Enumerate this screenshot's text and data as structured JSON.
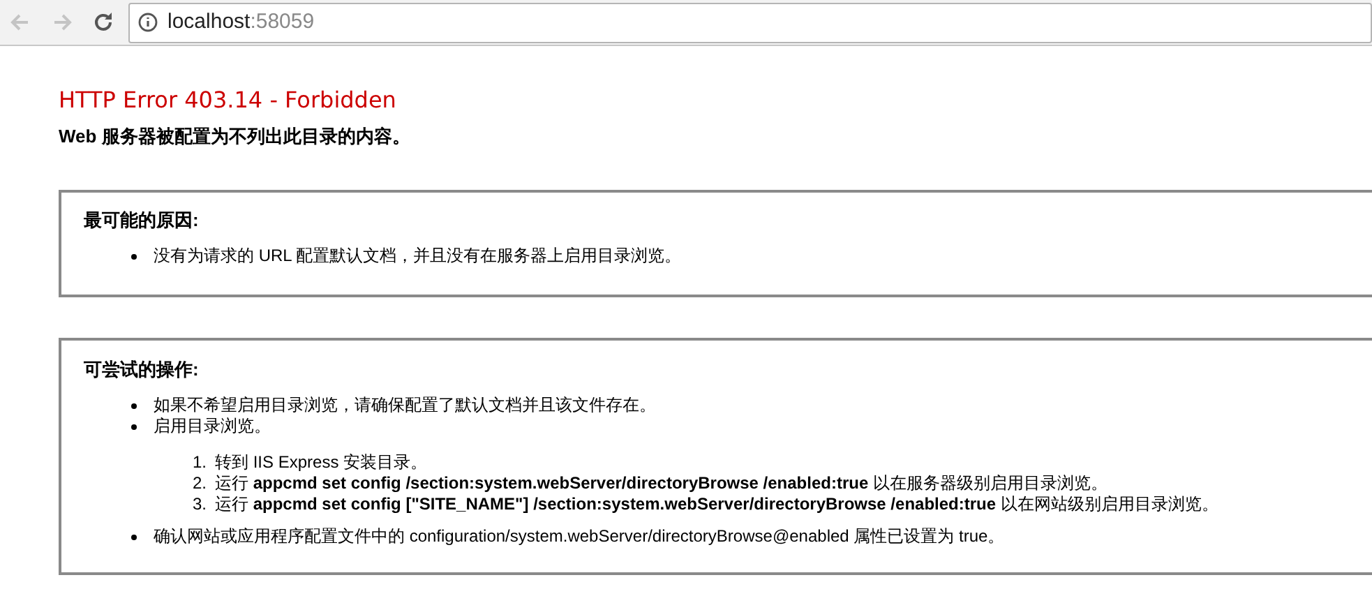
{
  "browser": {
    "address_host": "localhost",
    "address_port": ":58059"
  },
  "error": {
    "title": "HTTP Error 403.14 - Forbidden",
    "subtitle": "Web 服务器被配置为不列出此目录的内容。"
  },
  "sections": [
    {
      "heading": "最可能的原因:",
      "items": [
        {
          "text": "没有为请求的 URL 配置默认文档，并且没有在服务器上启用目录浏览。"
        }
      ]
    },
    {
      "heading": "可尝试的操作:",
      "items": [
        {
          "text": "如果不希望启用目录浏览，请确保配置了默认文档并且该文件存在。"
        },
        {
          "text": "启用目录浏览。",
          "steps": [
            {
              "number": "1.",
              "text": "转到 IIS Express 安装目录。"
            },
            {
              "number": "2.",
              "text": "运行 **appcmd set config /section:system.webServer/directoryBrowse /enabled:true** 以在服务器级别启用目录浏览。"
            },
            {
              "number": "3.",
              "text": "运行 **appcmd set config [\"SITE_NAME\"] /section:system.webServer/directoryBrowse /enabled:true** 以在网站级别启用目录浏览。"
            }
          ]
        },
        {
          "text": "确认网站或应用程序配置文件中的 configuration/system.webServer/directoryBrowse@enabled 属性已设置为 true。"
        }
      ]
    }
  ]
}
